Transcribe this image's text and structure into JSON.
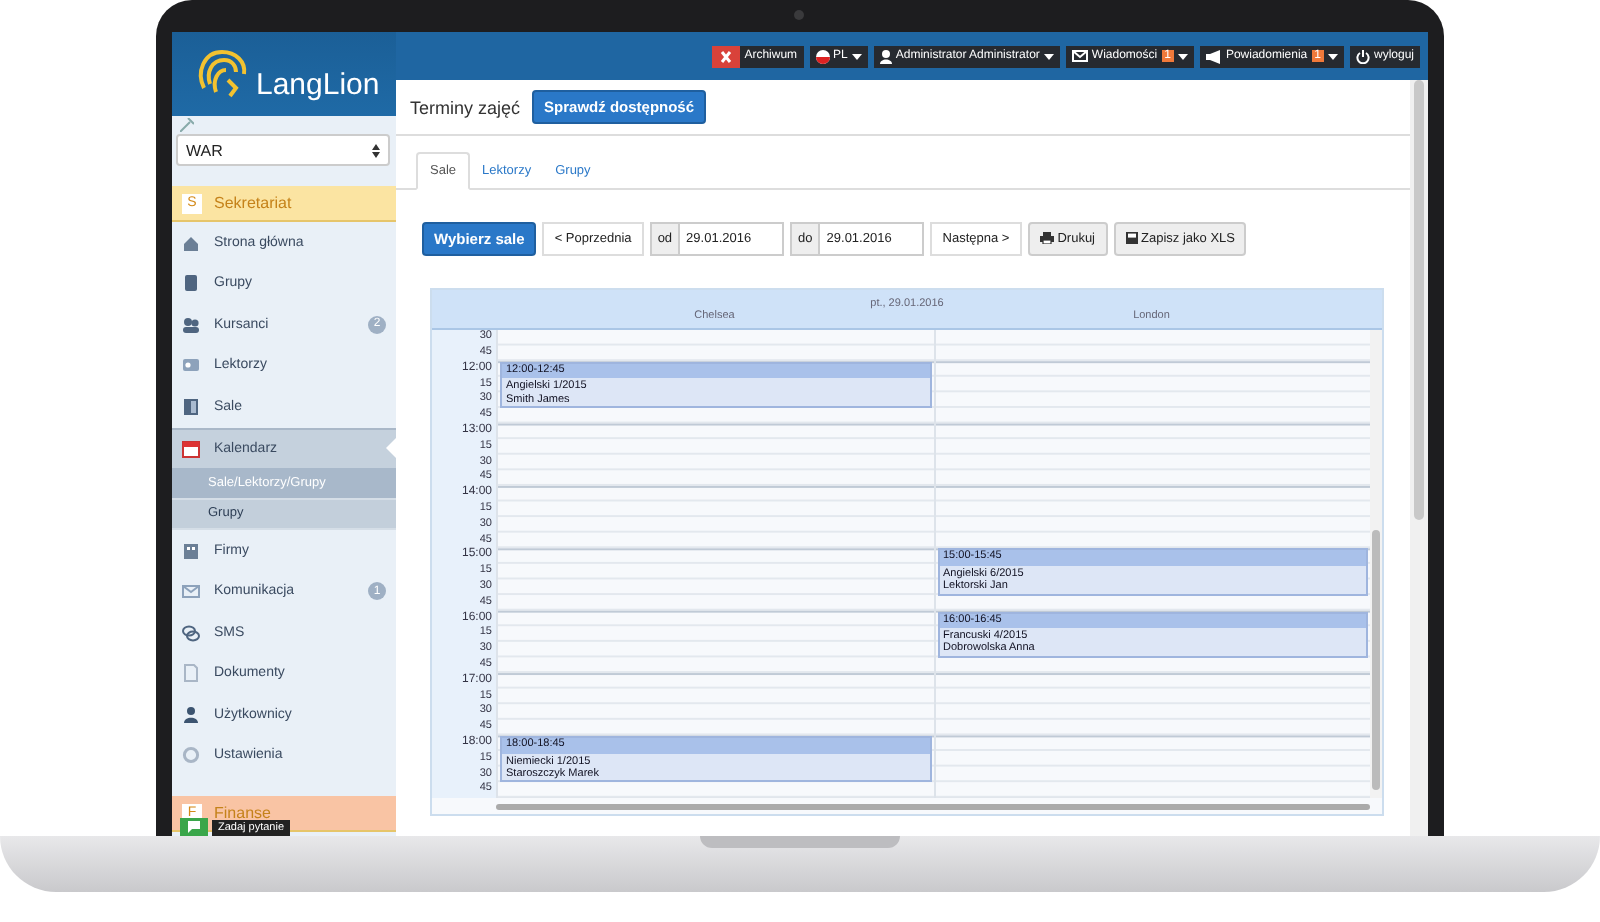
{
  "app": {
    "logo": "LangLion",
    "branch_select": "WAR"
  },
  "top_bar": {
    "archive": "Archiwum",
    "language": "PL",
    "user": "Administrator Administrator",
    "messages": {
      "label": "Wiadomości",
      "badge": "1"
    },
    "notifications": {
      "label": "Powiadomienia",
      "badge": "1"
    },
    "logout": "wyloguj"
  },
  "sidebar": {
    "sections": [
      {
        "letter": "S",
        "title": "Sekretariat",
        "color": "#fbe4a2",
        "items": [
          {
            "label": "Strona główna",
            "selected": false
          },
          {
            "label": "Grupy",
            "selected": false
          },
          {
            "label": "Kursanci",
            "selected": false,
            "badge": "2"
          },
          {
            "label": "Lektorzy",
            "selected": false
          },
          {
            "label": "Sale",
            "selected": false
          },
          {
            "label": "Kalendarz",
            "selected": true,
            "children": [
              {
                "label": "Sale/Lektorzy/Grupy",
                "selected": true
              },
              {
                "label": "Grupy",
                "selected": false
              }
            ]
          },
          {
            "label": "Firmy",
            "selected": false
          },
          {
            "label": "Komunikacja",
            "selected": false,
            "badge": "1"
          },
          {
            "label": "SMS",
            "selected": false
          },
          {
            "label": "Dokumenty",
            "selected": false
          },
          {
            "label": "Użytkownicy",
            "selected": false
          },
          {
            "label": "Ustawienia",
            "selected": false
          }
        ]
      },
      {
        "letter": "F",
        "title": "Finanse",
        "color": "#f9c4a4"
      }
    ]
  },
  "help_chat": {
    "label": "Zadaj pytanie"
  },
  "page": {
    "title": "Terminy zajęć",
    "check_button": "Sprawdź dostępność",
    "tabs": [
      {
        "label": "Sale",
        "selected": true
      },
      {
        "label": "Lektorzy",
        "selected": false
      },
      {
        "label": "Grupy",
        "selected": false
      }
    ],
    "toolbar": {
      "select_button": "Wybierz sale",
      "prev": "< Poprzednia",
      "from": {
        "label": "od",
        "value": "29.01.2016"
      },
      "to": {
        "label": "do",
        "value": "29.01.2016"
      },
      "next": "Następna >",
      "print": "Drukuj",
      "export": "Zapisz jako XLS"
    }
  },
  "calendar": {
    "date": "pt., 29.01.2016",
    "time_slots": [
      "30",
      "45",
      "12:00",
      "15",
      "30",
      "45",
      "13:00",
      "15",
      "30",
      "45",
      "14:00",
      "15",
      "30",
      "45",
      "15:00",
      "15",
      "30",
      "45",
      "16:00",
      "15",
      "30",
      "45",
      "17:00",
      "15",
      "30",
      "45",
      "18:00",
      "15",
      "30",
      "45"
    ],
    "columns": [
      {
        "name": "Chelsea",
        "events": [
          {
            "time": "12:00-12:45",
            "course": "Angielski 1/2015",
            "teacher": "Smith James"
          },
          {
            "time": "18:00-18:45",
            "course": "Niemiecki 1/2015",
            "teacher": "Staroszczyk Marek"
          }
        ]
      },
      {
        "name": "London",
        "events": [
          {
            "time": "15:00-15:45",
            "course": "Angielski 6/2015",
            "teacher": "Lektorski Jan"
          },
          {
            "time": "16:00-16:45",
            "course": "Francuski 4/2015",
            "teacher": "Dobrowolska Anna"
          }
        ]
      }
    ]
  }
}
